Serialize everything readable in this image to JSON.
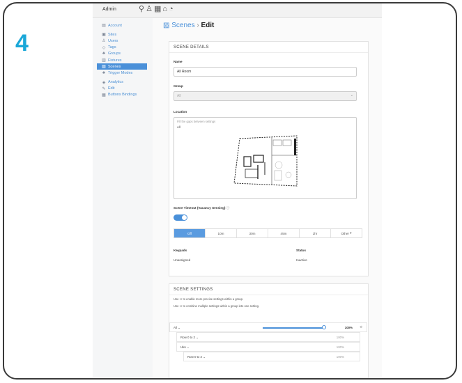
{
  "step_number": "4",
  "topbar": {
    "user": "Admin",
    "icons": [
      "pin-icon",
      "user-icon",
      "grid-icon",
      "building-icon",
      "bell-icon"
    ]
  },
  "sidebar": {
    "items": [
      {
        "label": "Account",
        "icon": "account-icon"
      },
      {
        "label": "Sites",
        "icon": "sites-icon"
      },
      {
        "label": "Users",
        "icon": "users-icon"
      },
      {
        "label": "Tags",
        "icon": "tag-icon"
      },
      {
        "label": "Groups",
        "icon": "groups-icon"
      },
      {
        "label": "Fixtures",
        "icon": "fixtures-icon"
      },
      {
        "label": "Scenes",
        "icon": "scenes-icon",
        "active": true
      },
      {
        "label": "Trigger Modes",
        "icon": "trigger-icon"
      },
      {
        "label": "Analytics",
        "icon": "analytics-icon"
      },
      {
        "label": "Edit",
        "icon": "edit-icon"
      },
      {
        "label": "Buttons Bindings",
        "icon": "buttons-icon"
      }
    ]
  },
  "header": {
    "crumb": "Scenes",
    "separator": "›",
    "current": "Edit"
  },
  "scene_details": {
    "title": "SCENE DETAILS",
    "name_label": "Name",
    "name_value": "All Room",
    "group_label": "Group",
    "group_value": "All",
    "location_label": "Location",
    "location_hint": "Fill the gaps between settings",
    "location_value": "All",
    "toggle_label": "Scene Timeout (Vacancy Sensing)",
    "toggle_on": true,
    "timeouts": [
      "Off",
      "10m",
      "30m",
      "45m",
      "1hr",
      "Other"
    ],
    "selected_timeout": "Off",
    "keypads_label": "Keypads",
    "keypads_value": "Unassigned",
    "status_label": "Status",
    "status_value": "Inactive"
  },
  "scene_settings": {
    "title": "SCENE SETTINGS",
    "hint1": "Use ☐ to enable more precise settings within a group.",
    "hint2": "Use ☐ to combine multiple settings within a group into one setting.",
    "root": {
      "name": "All",
      "level": 1.0,
      "level_text": "100%"
    },
    "rows": [
      {
        "name": "Row 0 to 2",
        "value": "100%"
      },
      {
        "name": "Ukn",
        "value": "100%"
      },
      {
        "name": "Row 0 to 2",
        "value": "100%"
      }
    ]
  }
}
